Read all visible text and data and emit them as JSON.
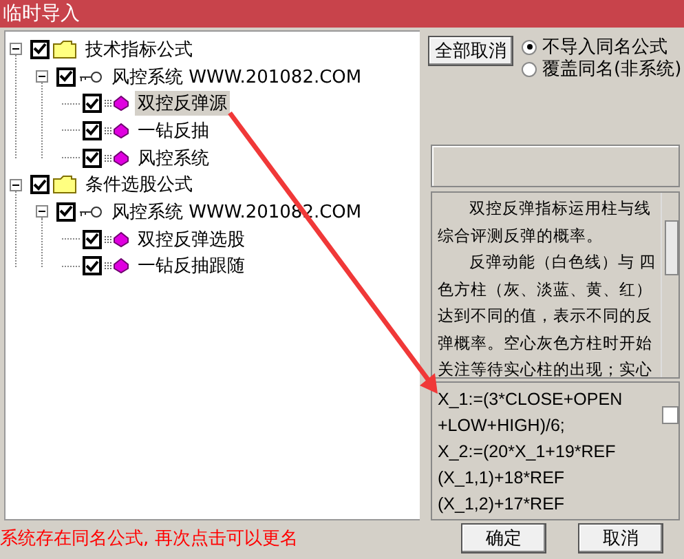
{
  "window": {
    "title": "临时导入"
  },
  "tree": [
    {
      "label": "技术指标公式",
      "kind": "folder",
      "checked": true,
      "expanded": true,
      "selected": false,
      "children": [
        {
          "label": "风控系统 WWW.201082.COM",
          "kind": "key",
          "checked": true,
          "expanded": true,
          "selected": false,
          "children": [
            {
              "label": "双控反弹源",
              "kind": "formula",
              "checked": true,
              "selected": true
            },
            {
              "label": "一钻反抽",
              "kind": "formula",
              "checked": true,
              "selected": false
            },
            {
              "label": "风控系统",
              "kind": "formula",
              "checked": true,
              "selected": false
            }
          ]
        }
      ]
    },
    {
      "label": "条件选股公式",
      "kind": "folder",
      "checked": true,
      "expanded": true,
      "selected": false,
      "children": [
        {
          "label": "风控系统 WWW.201082.COM",
          "kind": "key",
          "checked": true,
          "expanded": true,
          "selected": false,
          "children": [
            {
              "label": "双控反弹选股",
              "kind": "formula",
              "checked": true,
              "selected": false
            },
            {
              "label": "一钻反抽跟随",
              "kind": "formula",
              "checked": true,
              "selected": false
            }
          ]
        }
      ]
    }
  ],
  "cancel_all_button": "全部取消",
  "options": [
    {
      "label": "不导入同名公式",
      "selected": true
    },
    {
      "label": "覆盖同名(非系统)",
      "selected": false
    }
  ],
  "description": [
    "双控反弹指标运用柱与线综合评测反弹的概率。",
    "反弹动能（白色线）与 四色方柱（灰、淡蓝、黄、红）达到不同的值，表示不同的反弹概率。空心灰色方柱时开始关注等待实心柱的出现；实心"
  ],
  "formula_lines": [
    "X_1:=(3*CLOSE+OPEN",
    "+LOW+HIGH)/6;",
    "X_2:=(20*X_1+19*REF",
    "(X_1,1)+18*REF",
    "(X_1,2)+17*REF"
  ],
  "formula_checkbox": {
    "checked": false
  },
  "status": "系统存在同名公式, 再次点击可以更名",
  "buttons": [
    "确定",
    "取消"
  ]
}
